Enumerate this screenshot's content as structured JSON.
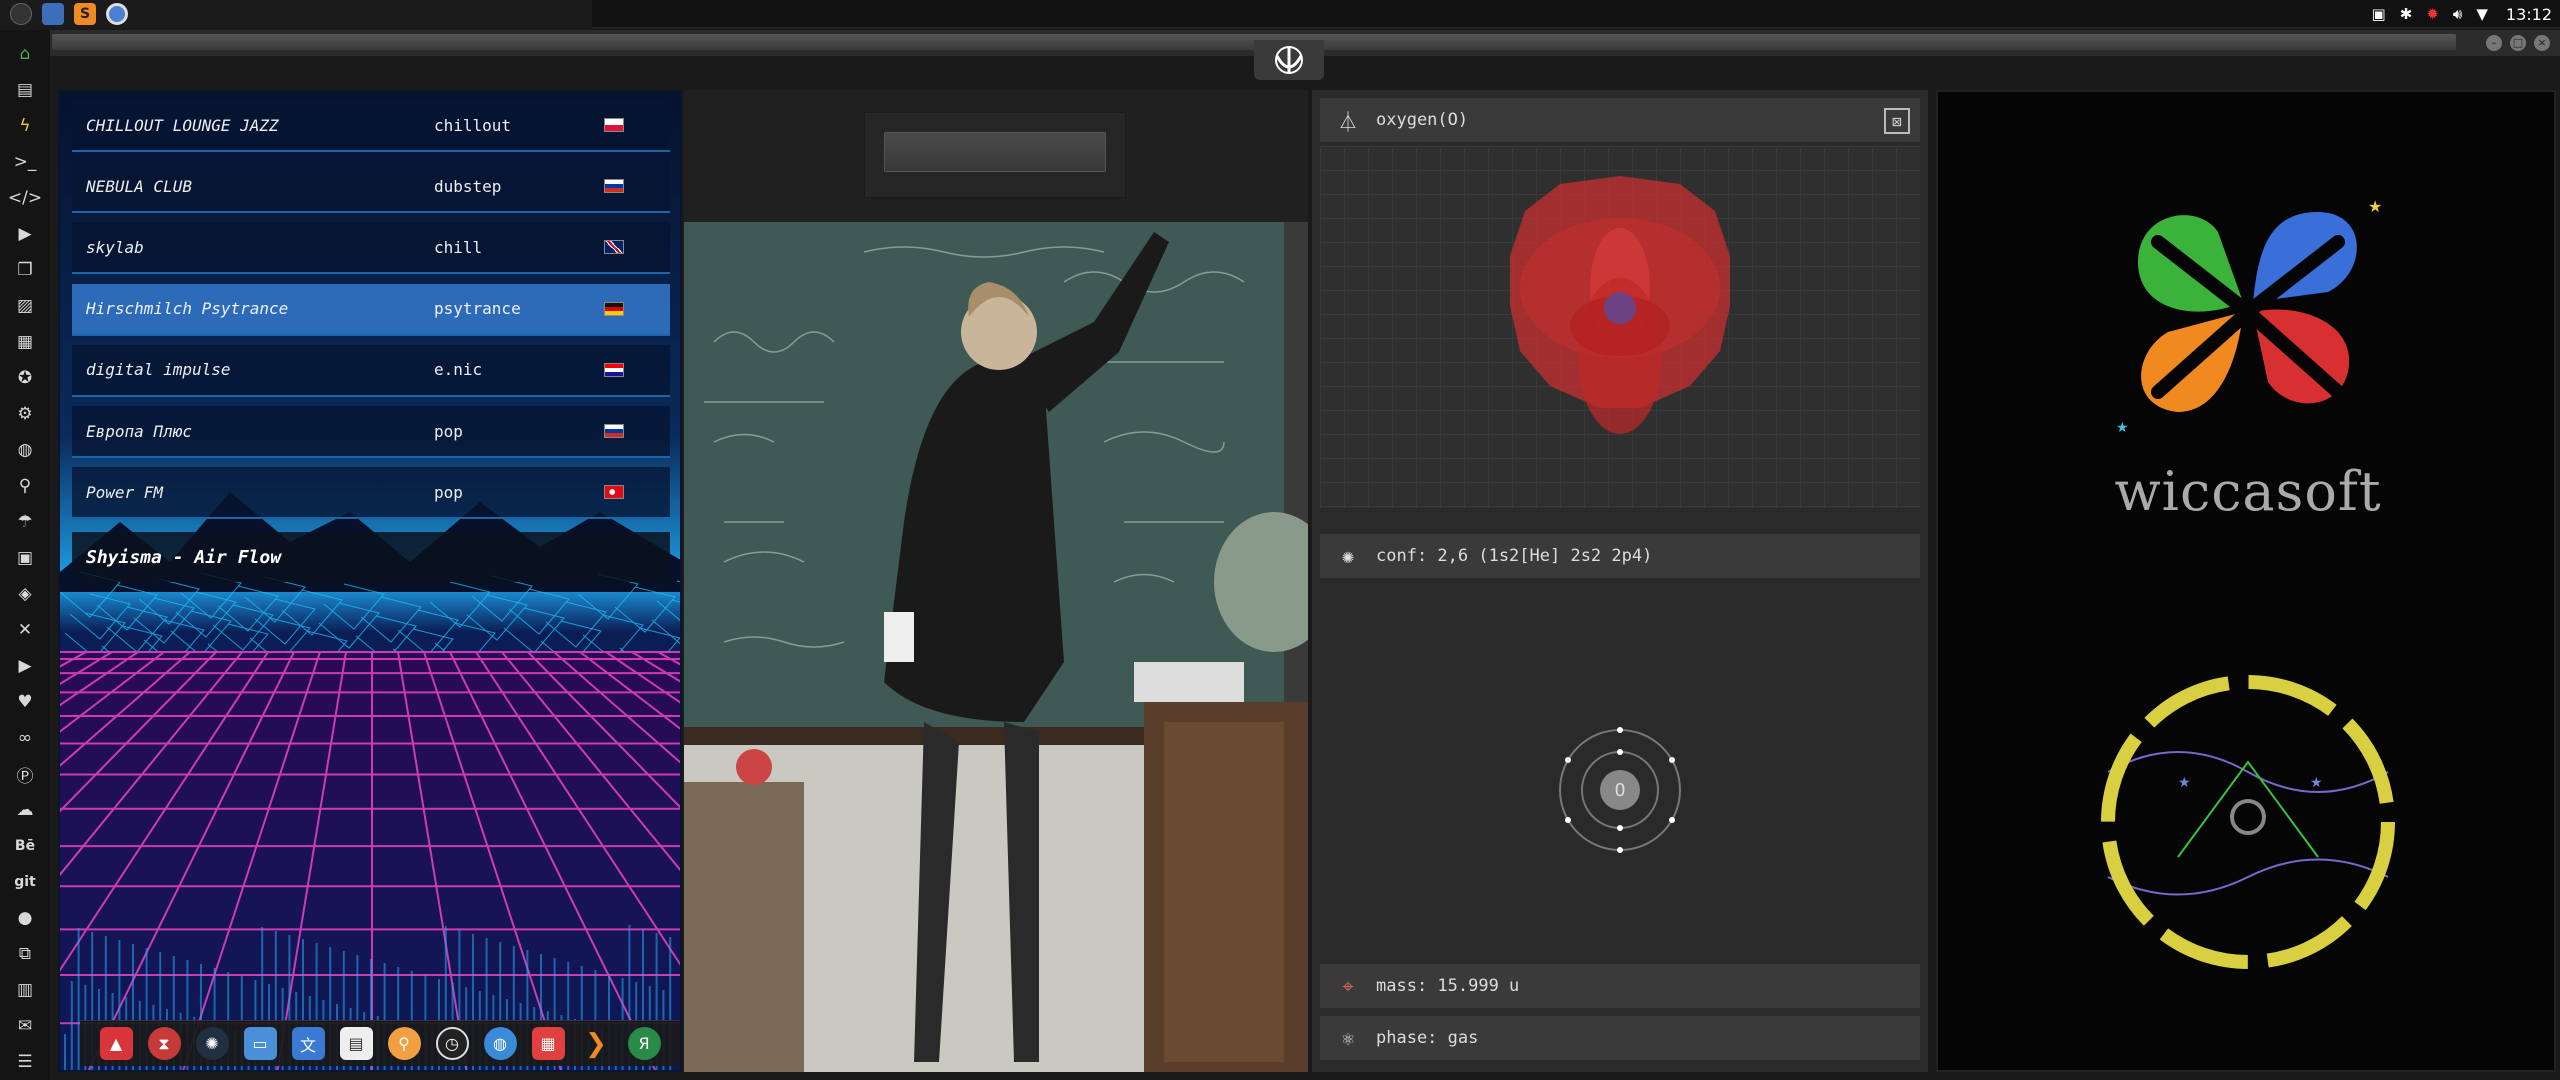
{
  "topbar": {
    "clock": "13:12"
  },
  "radio": {
    "stations": [
      {
        "name": "CHILLOUT LOUNGE JAZZ",
        "genre": "chillout",
        "flag": "pl"
      },
      {
        "name": "NEBULA CLUB",
        "genre": "dubstep",
        "flag": "ru"
      },
      {
        "name": "skylab",
        "genre": "chill",
        "flag": "gb"
      },
      {
        "name": "Hirschmilch Psytrance",
        "genre": "psytrance",
        "flag": "de"
      },
      {
        "name": "digital impulse",
        "genre": "e.nic",
        "flag": "hr"
      },
      {
        "name": "Европа Плюс",
        "genre": "pop",
        "flag": "ru"
      },
      {
        "name": "Power FM",
        "genre": "pop",
        "flag": "tr"
      }
    ],
    "selected_index": 3,
    "now_playing": "Shyisma - Air Flow"
  },
  "element": {
    "title": "oxygen(O)",
    "conf": "conf: 2,6 (1s2[He] 2s2 2p4)",
    "symbol": "O",
    "mass": "mass: 15.999 u",
    "phase": "phase: gas"
  },
  "brand": {
    "name": "wiccasoft"
  },
  "sidebar": {
    "behance_label": "Bē",
    "git_label": "git"
  },
  "colors": {
    "accent_green": "#4caf50",
    "selected_row": "#2d6bb8",
    "grid_magenta": "#e040c0",
    "grid_cyan": "#19c3ff",
    "orbital_red": "#c83030",
    "seal_yellow": "#d8d040"
  }
}
